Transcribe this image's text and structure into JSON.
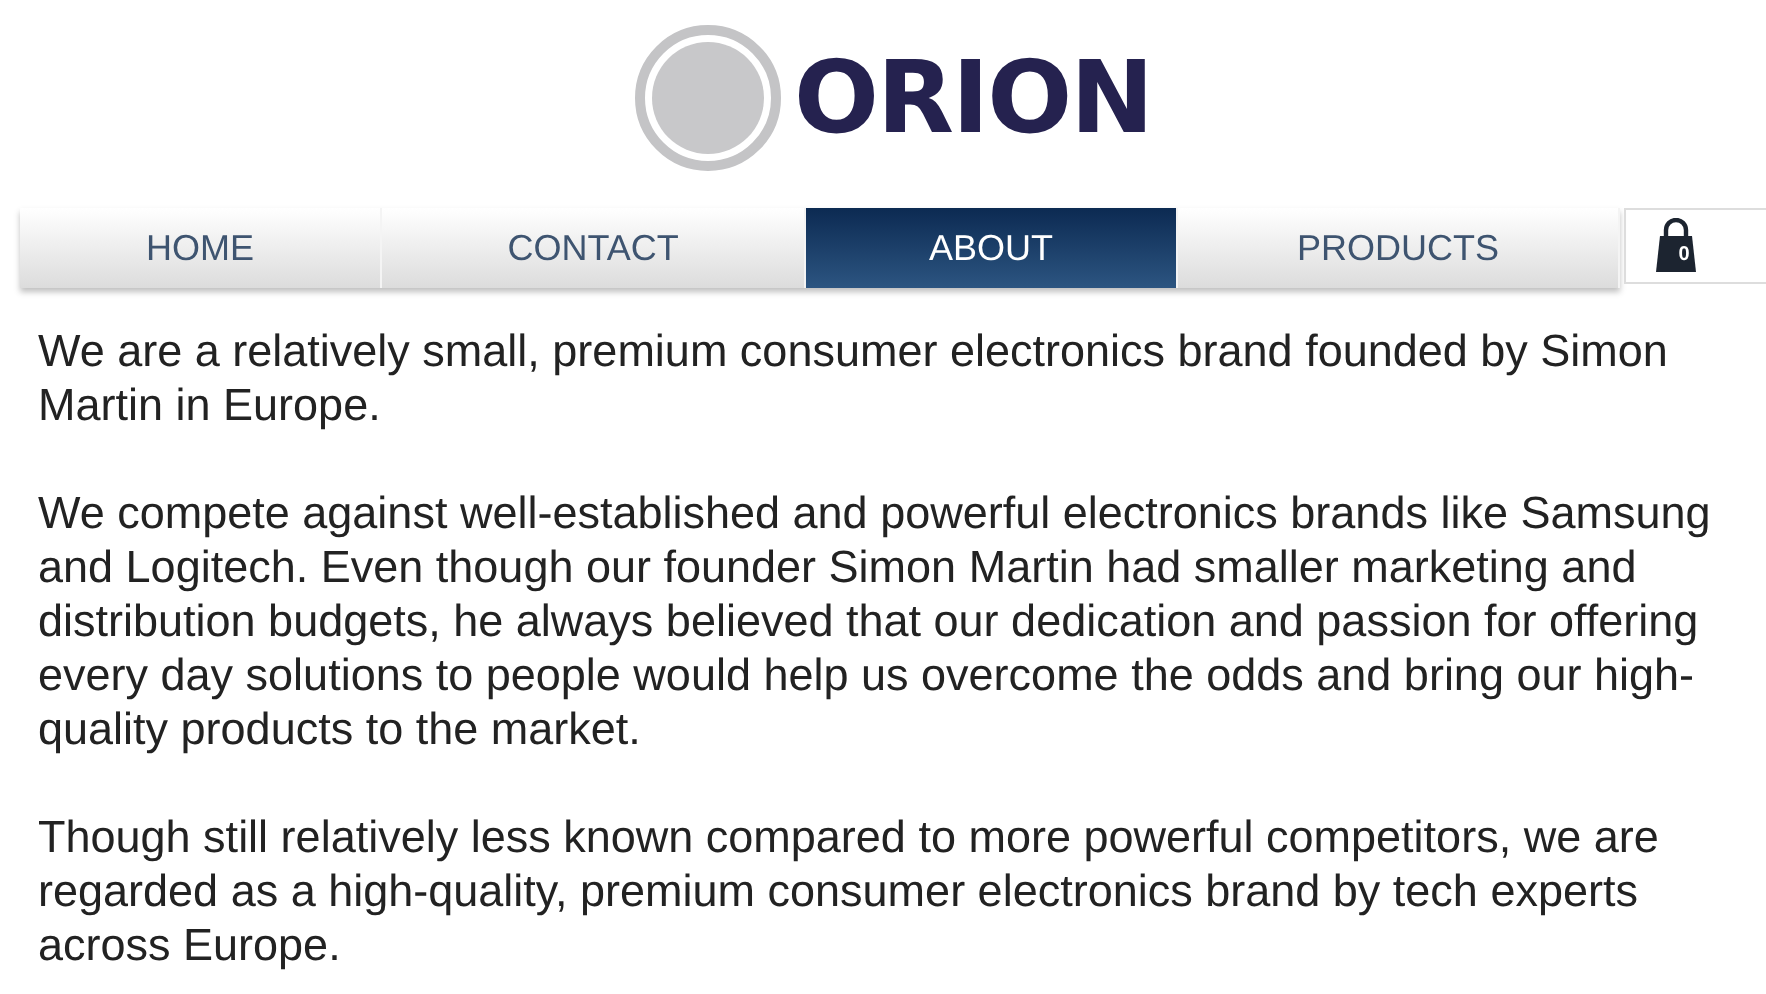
{
  "logo": {
    "text": "ORION"
  },
  "nav": {
    "tabs": [
      {
        "label": "HOME",
        "selected": false
      },
      {
        "label": "CONTACT",
        "selected": false
      },
      {
        "label": "ABOUT",
        "selected": true
      },
      {
        "label": "PRODUCTS",
        "selected": false
      }
    ],
    "cart": {
      "count": "0"
    }
  },
  "paragraphs": [
    "We are a relatively small, premium consumer electronics brand founded by Simon Martin in Europe.",
    "We compete against well-established and powerful electronics brands like Samsung and Logitech. Even though our founder Simon Martin had smaller marketing and distribution budgets, he always believed that our dedication and passion for offering every day solutions to people would help us overcome the odds and bring our high-quality products to the market.",
    "Though still relatively less known compared to more powerful competitors, we are regarded as a high-quality, premium consumer electronics brand by tech experts across Europe."
  ]
}
